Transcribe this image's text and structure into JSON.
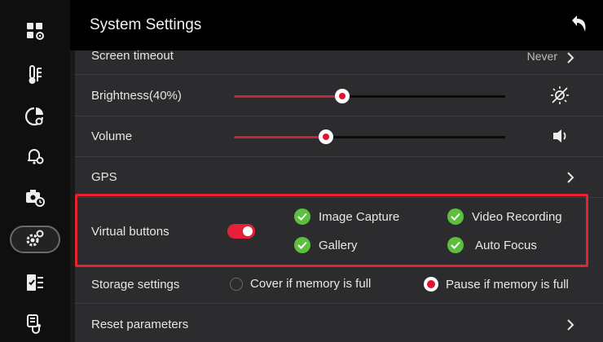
{
  "header": {
    "title": "System Settings",
    "back_icon": "back-arrow-icon"
  },
  "sidebar": {
    "items": [
      {
        "icon": "grid-settings-icon",
        "active": false
      },
      {
        "icon": "thermometer-icon",
        "active": false
      },
      {
        "icon": "pie-settings-icon",
        "active": false
      },
      {
        "icon": "bell-settings-icon",
        "active": false
      },
      {
        "icon": "camera-timer-icon",
        "active": false
      },
      {
        "icon": "gears-icon",
        "active": true
      },
      {
        "icon": "checklist-icon",
        "active": false
      },
      {
        "icon": "stethoscope-icon",
        "active": false
      }
    ]
  },
  "settings": {
    "screen_timeout": {
      "label": "Screen timeout",
      "value": "Never"
    },
    "brightness": {
      "label": "Brightness(40%)",
      "percent": 40,
      "icon": "brightness-off-icon"
    },
    "volume": {
      "label": "Volume",
      "percent": 34,
      "icon": "speaker-icon"
    },
    "gps": {
      "label": "GPS"
    },
    "virtual_buttons": {
      "label": "Virtual buttons",
      "enabled": true,
      "options": [
        "Image Capture",
        "Video Recording",
        "Gallery",
        "Auto Focus"
      ]
    },
    "storage": {
      "label": "Storage settings",
      "options": [
        "Cover if memory is full",
        "Pause if memory is full"
      ],
      "selected": "Pause if memory is full"
    },
    "reset": {
      "label": "Reset parameters"
    }
  },
  "colors": {
    "accent": "#e0142e",
    "check": "#5cbf3e",
    "highlight_border": "#e1262c"
  }
}
